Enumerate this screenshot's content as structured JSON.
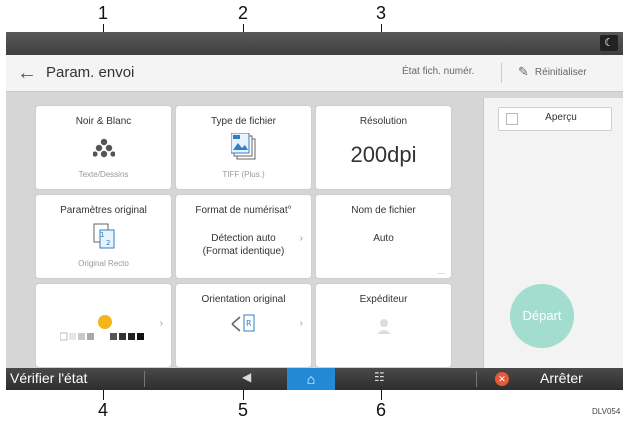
{
  "callouts": [
    "1",
    "2",
    "3",
    "4",
    "5",
    "6"
  ],
  "header": {
    "title": "Param. envoi",
    "state_link": "État fich. numér.",
    "reset": "Réinitialiser"
  },
  "tiles": {
    "color": {
      "label": "Noir & Blanc",
      "sub": "Texte/Dessins"
    },
    "file_type": {
      "label": "Type de fichier",
      "sub": "TIFF (Plus.)"
    },
    "resolution": {
      "label": "Résolution",
      "value": "200dpi"
    },
    "original_settings": {
      "label": "Paramètres original",
      "sub": "Original Recto"
    },
    "scan_format": {
      "label": "Format de numérisat°",
      "value_line1": "Détection auto",
      "value_line2": "(Format identique)"
    },
    "file_name": {
      "label": "Nom de fichier",
      "value": "Auto",
      "more": "..."
    },
    "orientation": {
      "label": "Orientation original"
    },
    "sender": {
      "label": "Expéditeur"
    }
  },
  "right_panel": {
    "preview": "Aperçu",
    "start": "Départ"
  },
  "bottom": {
    "check_state": "Vérifier l'état",
    "stop": "Arrêter"
  },
  "figure_code": "DLV054",
  "colors": {
    "home": "#2389d7",
    "start": "#a3ddd0",
    "stop": "#e55a3a",
    "accent_yellow": "#f3b51a"
  },
  "icons": [
    "moon-icon",
    "back-arrow-icon",
    "pen-icon",
    "dots-icon",
    "file-stack-icon",
    "preview-checkbox",
    "home-icon",
    "prev-icon",
    "grid-icon",
    "stop-icon",
    "chevron-right-icon"
  ]
}
